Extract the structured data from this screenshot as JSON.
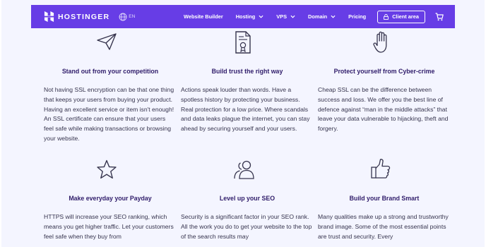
{
  "header": {
    "brand": "HOSTINGER",
    "lang": "EN",
    "nav": [
      {
        "label": "Website Builder",
        "dropdown": false
      },
      {
        "label": "Hosting",
        "dropdown": true
      },
      {
        "label": "VPS",
        "dropdown": true
      },
      {
        "label": "Domain",
        "dropdown": true
      },
      {
        "label": "Pricing",
        "dropdown": false
      }
    ],
    "client_area": "Client area",
    "accent_color": "#673de6"
  },
  "features": [
    {
      "icon": "paper-plane-icon",
      "title": "Stand out from your competition",
      "text": "Not having SSL encryption can be that one thing that keeps your users from buying your product. Having an excellent service or item isn't enough! An SSL certificate can ensure that your users feel safe while making transactions or browsing your website."
    },
    {
      "icon": "certificate-icon",
      "title": "Build trust the right way",
      "text": "Actions speak louder than words. Have a spotless history by protecting your business. Real protection for a low price. Where scandals and data leaks plague the internet, you can stay ahead by securing yourself and your users."
    },
    {
      "icon": "hand-stop-icon",
      "title": "Protect yourself from Cyber-crime",
      "text": "Cheap SSL can be the difference between success and loss. We offer you the best line of defence against “man in the middle attacks” that leave your data vulnerable to hijacking, theft and forgery."
    },
    {
      "icon": "star-icon",
      "title": "Make everyday your Payday",
      "text": "HTTPS will increase your SEO ranking, which means you get higher traffic. Let your customers feel safe when they buy from"
    },
    {
      "icon": "users-icon",
      "title": "Level up your SEO",
      "text": "Security is a significant factor in your SEO rank. All the work you do to get your website to the top of the search results may"
    },
    {
      "icon": "thumbs-up-icon",
      "title": "Build your Brand Smart",
      "text": "Many qualities make up a strong and trustworthy brand image. Some of the most essential points are trust and security. Every"
    }
  ]
}
